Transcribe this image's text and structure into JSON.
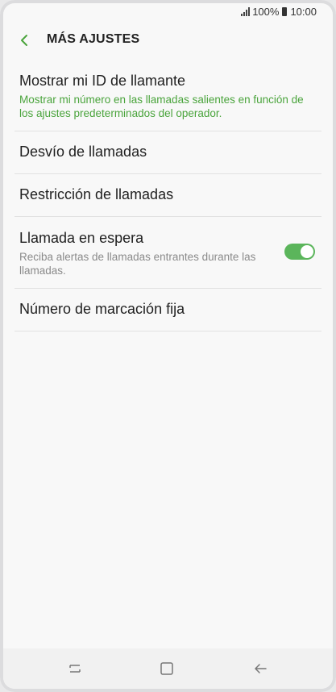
{
  "status_bar": {
    "battery_text": "100%",
    "time": "10:00"
  },
  "header": {
    "title": "MÁS AJUSTES"
  },
  "items": [
    {
      "title": "Mostrar mi ID de llamante",
      "subtitle": "Mostrar mi número en las llamadas salientes en función de los ajustes predeterminados del operador."
    },
    {
      "title": "Desvío de llamadas"
    },
    {
      "title": "Restricción de llamadas"
    },
    {
      "title": "Llamada en espera",
      "subtitle": "Reciba alertas de llamadas entrantes durante las llamadas.",
      "toggle_on": true
    },
    {
      "title": "Número de marcación fija"
    }
  ],
  "colors": {
    "accent_green": "#4aa43c",
    "toggle_on": "#5bb55b"
  },
  "icons": {
    "back": "back-arrow-icon",
    "nav_recent": "recent-apps-icon",
    "nav_home": "home-icon",
    "nav_back": "back-icon"
  }
}
